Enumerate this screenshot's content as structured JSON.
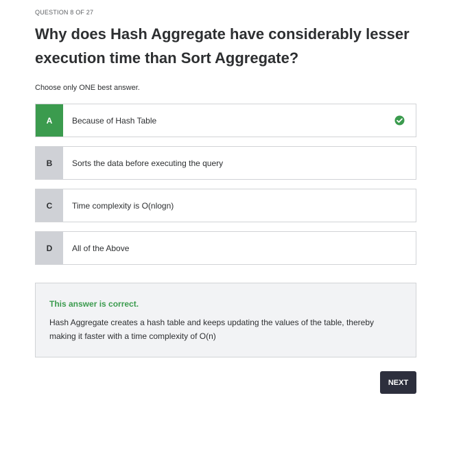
{
  "progress": "QUESTION 8 OF 27",
  "question": "Why does Hash Aggregate have considerably lesser execution time than Sort Aggregate?",
  "instruction": "Choose only ONE best answer.",
  "options": [
    {
      "letter": "A",
      "text": "Because of Hash Table",
      "selected": true,
      "correct": true
    },
    {
      "letter": "B",
      "text": "Sorts the data before executing the query",
      "selected": false,
      "correct": false
    },
    {
      "letter": "C",
      "text": "Time complexity is O(nlogn)",
      "selected": false,
      "correct": false
    },
    {
      "letter": "D",
      "text": "All of the Above",
      "selected": false,
      "correct": false
    }
  ],
  "feedback": {
    "status": "This answer is correct.",
    "explanation": "Hash Aggregate creates a hash table and keeps updating the values of the table, thereby making it faster with a time complexity of O(n)"
  },
  "next_label": "NEXT",
  "colors": {
    "correct": "#3b9b4e",
    "letter_bg": "#cfd1d6",
    "button_bg": "#2d2f3d",
    "feedback_bg": "#f2f3f5"
  },
  "icons": {
    "correct_marker": "check-circle-icon"
  }
}
